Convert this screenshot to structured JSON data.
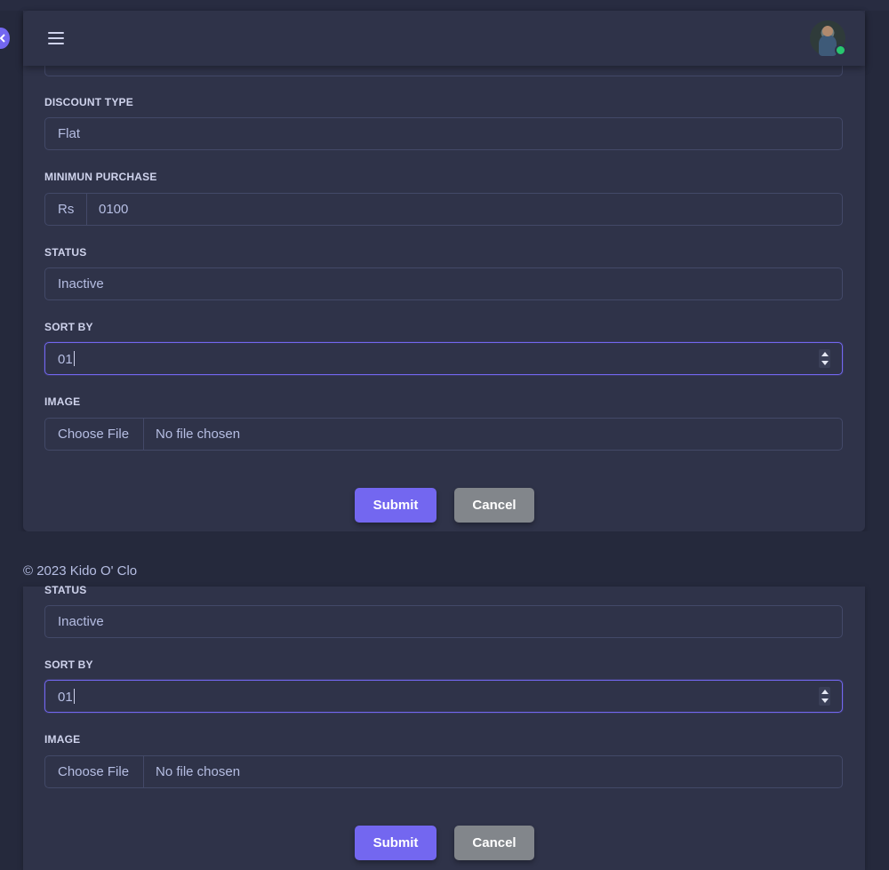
{
  "form_top": {
    "discount_type": {
      "label": "DISCOUNT TYPE",
      "value": "Flat"
    },
    "minimum_purchase": {
      "label": "MINIMUN PURCHASE",
      "prefix": "Rs",
      "value": "0100"
    },
    "status": {
      "label": "STATUS",
      "value": "Inactive"
    },
    "sort_by": {
      "label": "SORT BY",
      "value": "01"
    },
    "image": {
      "label": "IMAGE",
      "button": "Choose File",
      "status": "No file chosen"
    },
    "submit": "Submit",
    "cancel": "Cancel"
  },
  "footer": {
    "copyright": "© 2023 Kido O' Clo"
  },
  "form_bottom": {
    "status": {
      "label": "STATUS",
      "value": "Inactive"
    },
    "sort_by": {
      "label": "SORT BY",
      "value": "01"
    },
    "image": {
      "label": "IMAGE",
      "button": "Choose File",
      "status": "No file chosen"
    },
    "submit": "Submit",
    "cancel": "Cancel"
  },
  "colors": {
    "primary": "#7367f0",
    "secondary": "#82868b",
    "online": "#28c76f"
  }
}
